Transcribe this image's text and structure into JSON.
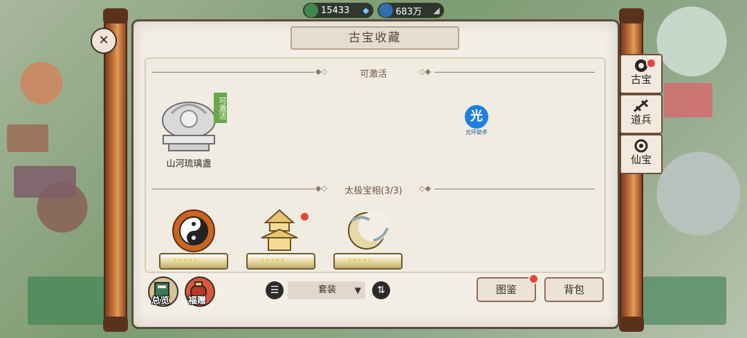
{
  "currency": {
    "jade_value": "15433",
    "spirit_value": "683万",
    "jade_icon": "jade-coin-icon",
    "spirit_icon": "spirit-droplet-icon",
    "add_icon": "plus-icon"
  },
  "window": {
    "title": "古宝收藏"
  },
  "sections": {
    "activatable": {
      "title": "可激活",
      "items": [
        {
          "name": "山河琉璃盏",
          "badge": "可激活"
        }
      ]
    },
    "taiji": {
      "title": "太极宝相(3/3)",
      "items": [
        {
          "stars": "★★★★★",
          "has_dot": false
        },
        {
          "stars": "★★★★★",
          "has_dot": true
        },
        {
          "stars": "★★★★★",
          "has_dot": false
        }
      ]
    }
  },
  "watermark": {
    "label": "光环助手",
    "glyph": "光"
  },
  "tabs": [
    {
      "label": "古宝",
      "icon": "treasure-tab-icon",
      "has_dot": true
    },
    {
      "label": "道兵",
      "icon": "weapon-tab-icon",
      "has_dot": false
    },
    {
      "label": "仙宝",
      "icon": "immortal-tab-icon",
      "has_dot": false
    }
  ],
  "bottom": {
    "overview_label": "总览",
    "gift_label": "福赠",
    "filter_value": "套装",
    "catalog_label": "图鉴",
    "bag_label": "背包"
  },
  "colors": {
    "accent_green": "#6aa64a",
    "notification_red": "#e0473c",
    "star_gold": "#f6c547"
  }
}
